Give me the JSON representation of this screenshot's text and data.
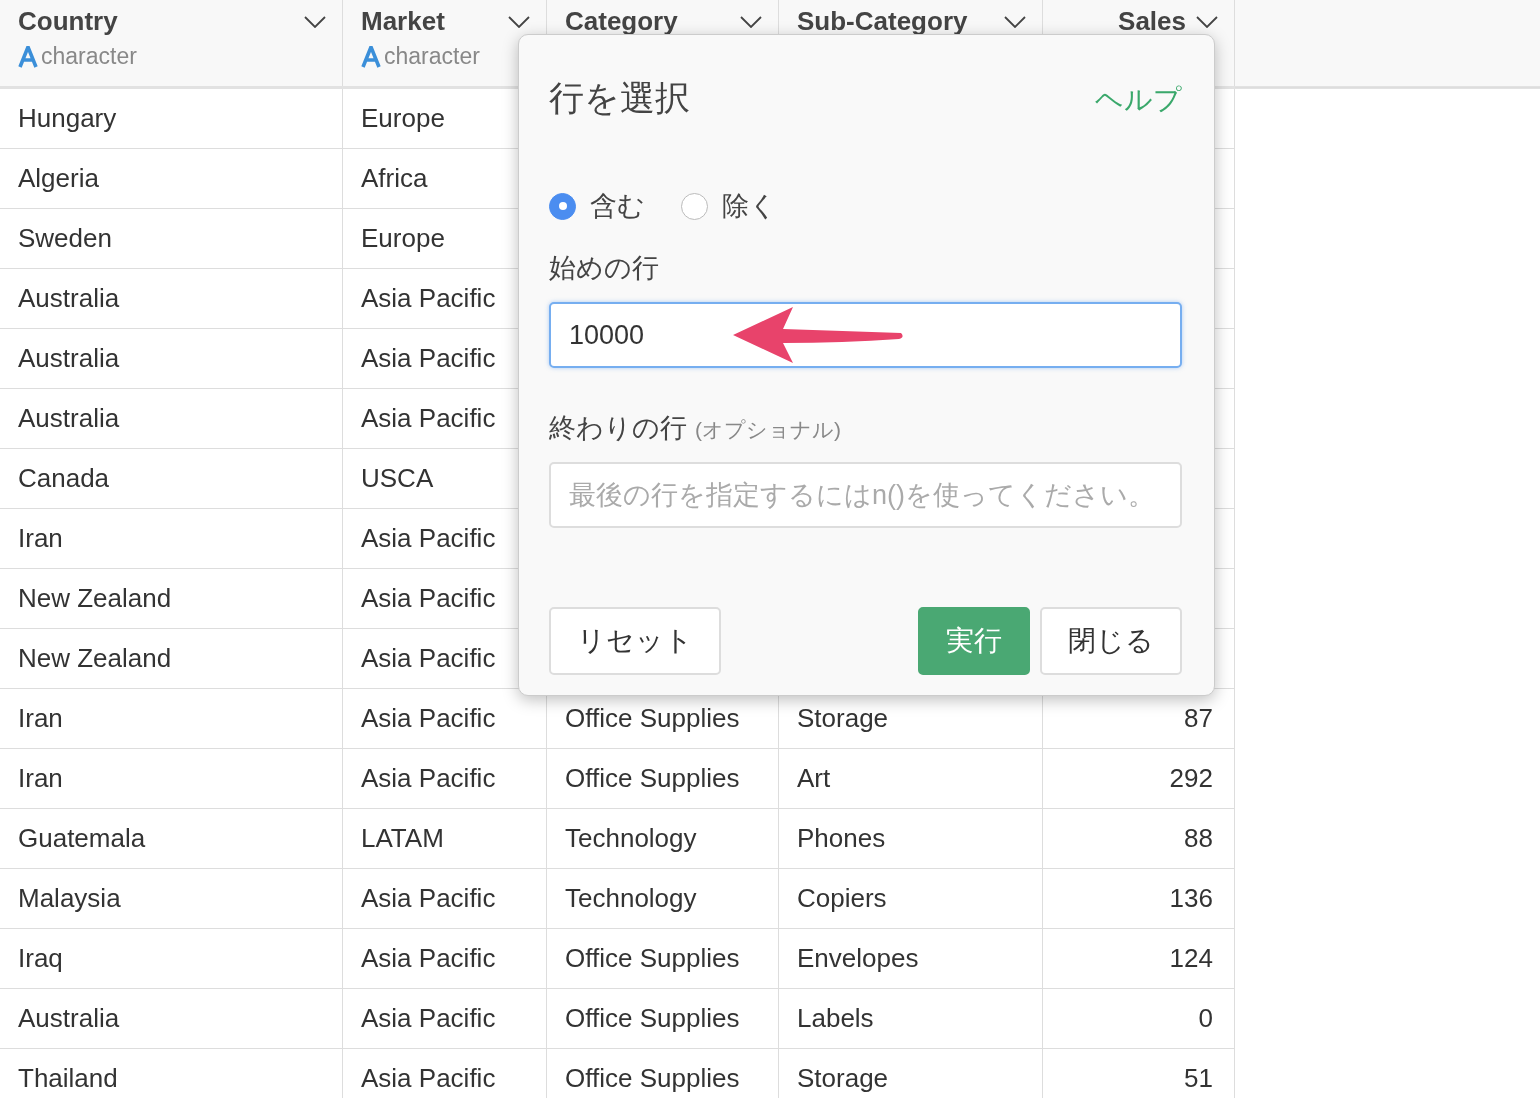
{
  "table": {
    "columns": [
      {
        "name": "Country",
        "type": "character"
      },
      {
        "name": "Market",
        "type": "character"
      },
      {
        "name": "Category"
      },
      {
        "name": "Sub-Category"
      },
      {
        "name": "Sales"
      }
    ],
    "rows": [
      {
        "country": "Hungary",
        "market": "Europe"
      },
      {
        "country": "Algeria",
        "market": "Africa"
      },
      {
        "country": "Sweden",
        "market": "Europe"
      },
      {
        "country": "Australia",
        "market": "Asia Pacific"
      },
      {
        "country": "Australia",
        "market": "Asia Pacific"
      },
      {
        "country": "Australia",
        "market": "Asia Pacific"
      },
      {
        "country": "Canada",
        "market": "USCA"
      },
      {
        "country": "Iran",
        "market": "Asia Pacific"
      },
      {
        "country": "New Zealand",
        "market": "Asia Pacific"
      },
      {
        "country": "New Zealand",
        "market": "Asia Pacific"
      },
      {
        "country": "Iran",
        "market": "Asia Pacific",
        "category": "Office Supplies",
        "sub_category": "Storage",
        "sales": "87"
      },
      {
        "country": "Iran",
        "market": "Asia Pacific",
        "category": "Office Supplies",
        "sub_category": "Art",
        "sales": "292"
      },
      {
        "country": "Guatemala",
        "market": "LATAM",
        "category": "Technology",
        "sub_category": "Phones",
        "sales": "88"
      },
      {
        "country": "Malaysia",
        "market": "Asia Pacific",
        "category": "Technology",
        "sub_category": "Copiers",
        "sales": "136"
      },
      {
        "country": "Iraq",
        "market": "Asia Pacific",
        "category": "Office Supplies",
        "sub_category": "Envelopes",
        "sales": "124"
      },
      {
        "country": "Australia",
        "market": "Asia Pacific",
        "category": "Office Supplies",
        "sub_category": "Labels",
        "sales": "0"
      },
      {
        "country": "Thailand",
        "market": "Asia Pacific",
        "category": "Office Supplies",
        "sub_category": "Storage",
        "sales": "51"
      }
    ]
  },
  "dialog": {
    "title": "行を選択",
    "help_link": "ヘルプ",
    "mode_options": [
      {
        "label": "含む",
        "selected": true
      },
      {
        "label": "除く",
        "selected": false
      }
    ],
    "start_row": {
      "label": "始めの行",
      "value": "10000"
    },
    "end_row": {
      "label": "終わりの行",
      "note": "(オプショナル)",
      "placeholder": "最後の行を指定するにはn()を使ってください。"
    },
    "buttons": [
      {
        "label": "リセット",
        "kind": "secondary"
      },
      {
        "label": "実行",
        "kind": "primary"
      },
      {
        "label": "閉じる",
        "kind": "secondary"
      }
    ]
  }
}
